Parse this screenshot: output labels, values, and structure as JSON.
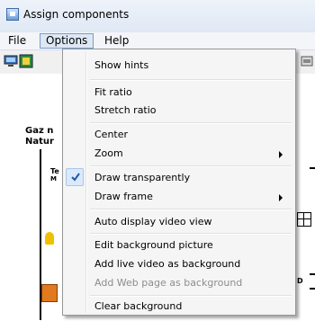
{
  "window": {
    "title": "Assign components"
  },
  "menubar": {
    "items": [
      "File",
      "Options",
      "Help"
    ]
  },
  "canvas": {
    "partial_text_1": "Gaz n",
    "partial_text_2": "Natur",
    "partial_text_3": "Te",
    "partial_text_4": "M",
    "partial_text_5": "D"
  },
  "options_menu": {
    "show_hints": "Show hints",
    "fit_ratio": "Fit ratio",
    "stretch_ratio": "Stretch ratio",
    "center": "Center",
    "zoom": "Zoom",
    "draw_transparently": "Draw transparently",
    "draw_frame": "Draw frame",
    "auto_display_video_view": "Auto display video view",
    "edit_background_picture": "Edit background picture",
    "add_live_video_as_background": "Add live video as background",
    "add_web_page_as_background": "Add Web page as background",
    "clear_background": "Clear background",
    "draw_transparently_checked": true,
    "add_web_page_disabled": true
  }
}
